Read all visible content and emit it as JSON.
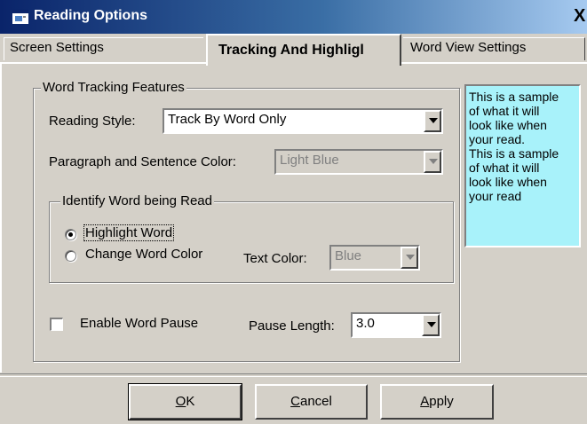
{
  "window": {
    "title": "Reading Options",
    "close_label": "X"
  },
  "tabs": [
    {
      "label": "Screen  Settings"
    },
    {
      "label": "Tracking And Highligl",
      "active": true
    },
    {
      "label": "Word View Settings"
    }
  ],
  "word_tracking": {
    "legend": "Word Tracking Features",
    "reading_style_label": "Reading Style:",
    "reading_style_value": "Track By Word Only",
    "para_color_label": "Paragraph and Sentence Color:",
    "para_color_value": "Light Blue"
  },
  "identify": {
    "legend": "Identify Word being Read",
    "option_highlight": "Highlight Word",
    "option_change_color": "Change Word Color",
    "text_color_label": "Text Color:",
    "text_color_value": "Blue",
    "selected": "highlight"
  },
  "pause": {
    "enable_label": "Enable Word Pause",
    "enabled": false,
    "length_label": "Pause Length:",
    "length_value": "3.0"
  },
  "sample": {
    "lines": [
      "This is a sample",
      "of what it will",
      "look like when",
      "your read.",
      "This is a sample",
      "of what it will",
      "look like when",
      "your read"
    ],
    "background": "#a8f2fa"
  },
  "buttons": {
    "ok_mnemonic": "O",
    "ok_rest": "K",
    "cancel_mnemonic": "C",
    "cancel_rest": "ancel",
    "apply_mnemonic": "A",
    "apply_rest": "pply"
  },
  "colors": {
    "titlebar_start": "#0a246a",
    "titlebar_end": "#a6caf0",
    "dialog_bg": "#d4d0c8"
  }
}
